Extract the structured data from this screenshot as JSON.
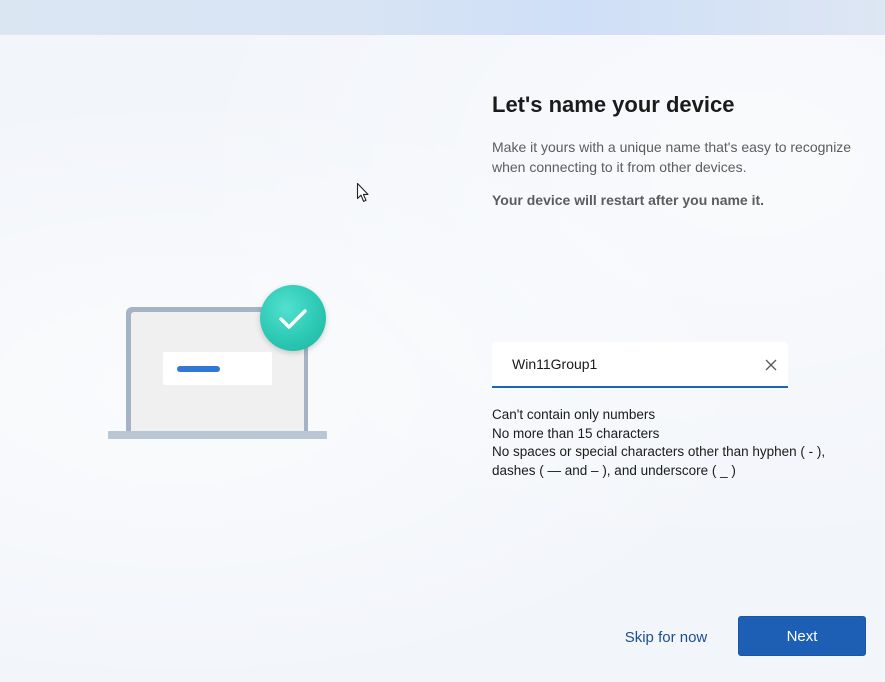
{
  "header": {
    "title": "Let's name your device",
    "description": "Make it yours with a unique name that's easy to recognize when connecting to it from other devices.",
    "warning": "Your device will restart after you name it."
  },
  "device_name_input": {
    "value": "Win11Group1",
    "clear_icon": "close-icon"
  },
  "rules": [
    "Can't contain only numbers",
    "No more than 15 characters",
    "No spaces or special characters other than hyphen ( - ),",
    "dashes ( — and – ), and underscore ( _ )"
  ],
  "footer": {
    "skip_label": "Skip for now",
    "next_label": "Next"
  },
  "illustration": {
    "icons": [
      "laptop-icon",
      "checkmark-icon"
    ],
    "accent_color": "#2cc9b4",
    "bar_color": "#3178d6"
  },
  "colors": {
    "primary_button": "#1d5fb5",
    "link": "#1a4f8f",
    "input_underline": "#1e63b8"
  }
}
